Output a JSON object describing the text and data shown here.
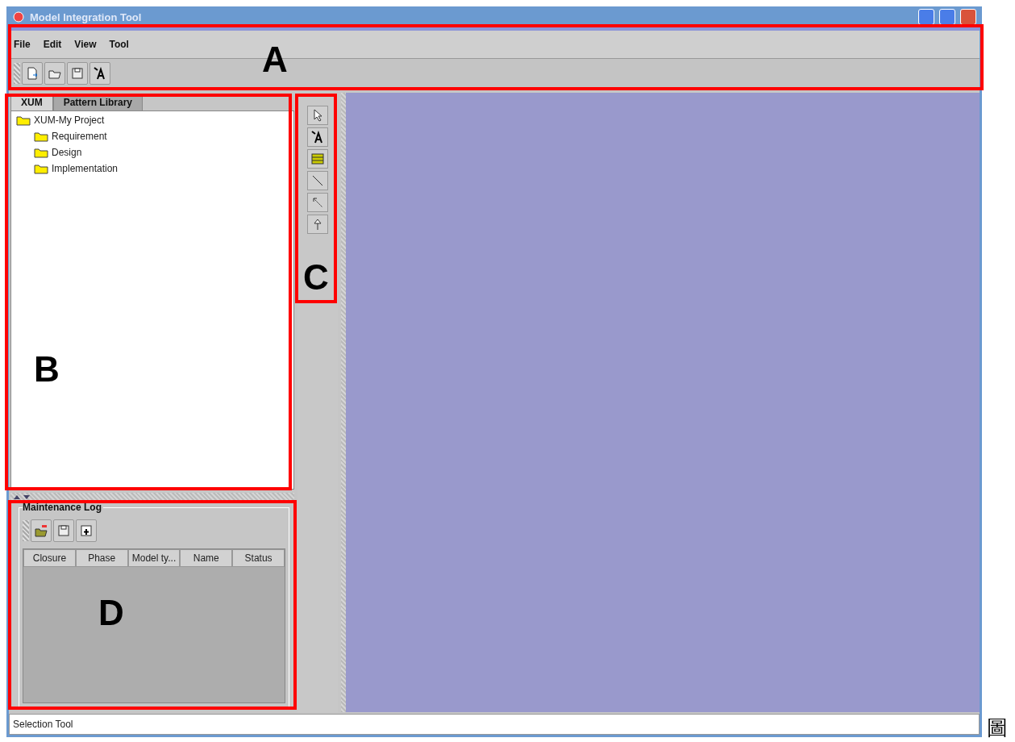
{
  "window": {
    "title": "Model Integration Tool"
  },
  "menu": [
    "File",
    "Edit",
    "View",
    "Tool"
  ],
  "toolbar": [
    {
      "kind": "new"
    },
    {
      "kind": "open"
    },
    {
      "kind": "save"
    },
    {
      "kind": "text"
    }
  ],
  "tabs": [
    {
      "label": "XUM",
      "selected": true
    },
    {
      "label": "Pattern Library",
      "selected": false
    }
  ],
  "tree": {
    "label": "XUM-My Project",
    "children": [
      {
        "label": "Requirement"
      },
      {
        "label": "Design"
      },
      {
        "label": "Implementation"
      }
    ]
  },
  "palette": [
    {
      "kind": "select"
    },
    {
      "kind": "text"
    },
    {
      "kind": "box"
    },
    {
      "kind": "line"
    },
    {
      "kind": "arrow"
    },
    {
      "kind": "inherit"
    }
  ],
  "maintenance_log": {
    "title": "Maintenance Log",
    "toolbar": [
      {
        "kind": "open"
      },
      {
        "kind": "save"
      },
      {
        "kind": "add"
      }
    ],
    "columns": [
      "Closure",
      "Phase",
      "Model ty...",
      "Name",
      "Status"
    ]
  },
  "status_bar": "Selection Tool",
  "annotations": [
    {
      "label": "A"
    },
    {
      "label": "B"
    },
    {
      "label": "C"
    },
    {
      "label": "D"
    }
  ],
  "caption": "圖"
}
